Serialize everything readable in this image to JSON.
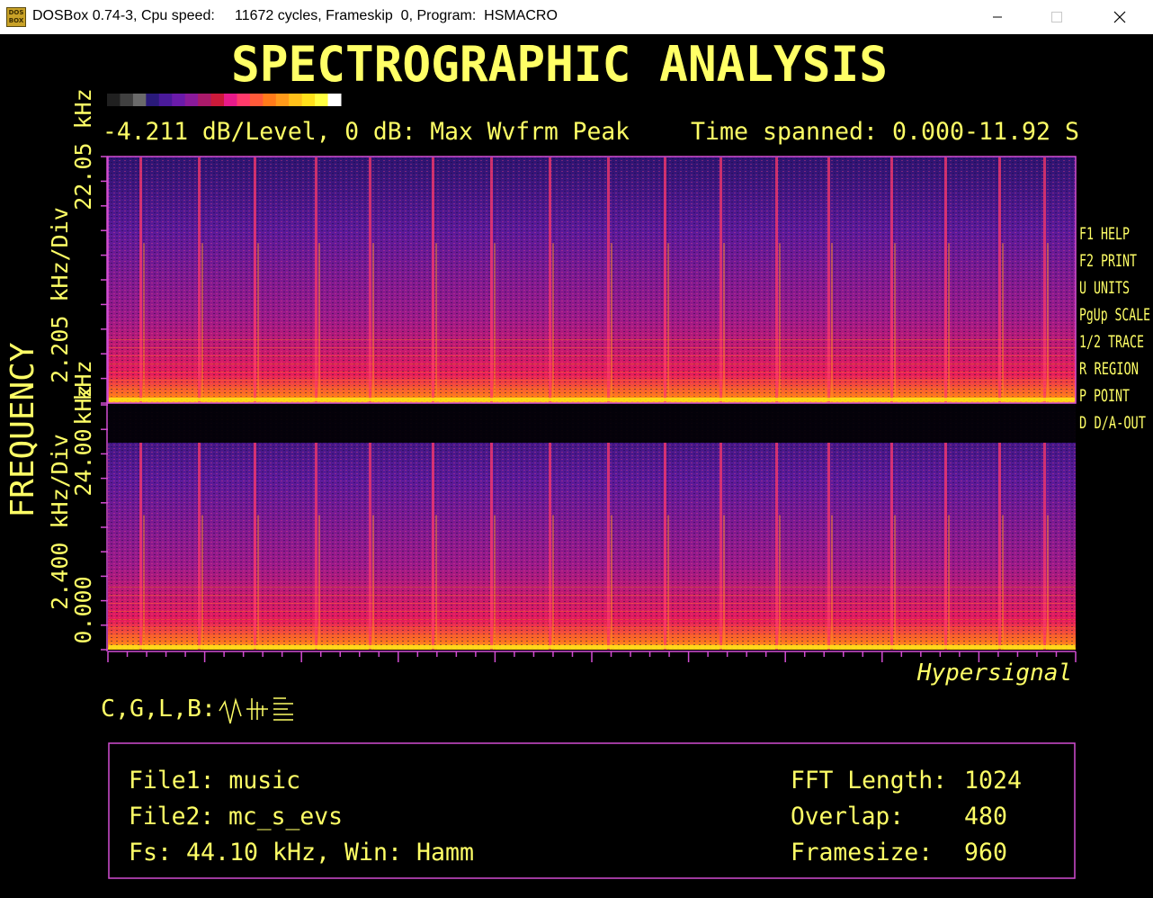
{
  "window": {
    "title": "DOSBox 0.74-3, Cpu speed:     11672 cycles, Frameskip  0, Program:  HSMACRO",
    "icon": "dosbox-icon",
    "icon_text": "DOS BOX"
  },
  "screen": {
    "title": "SPECTROGRAPHIC ANALYSIS",
    "level_info": "-4.211 dB/Level, 0 dB: Max Wvfrm Peak",
    "time_spanned": "Time spanned: 0.000-11.92 S",
    "y_axis_label": "FREQUENCY",
    "top_axis": {
      "scale": "2.205 kHz/Div",
      "top_value": "22.05 kHz",
      "bottom_value": "kHz"
    },
    "bottom_axis": {
      "scale": "2.400 kHz/Div",
      "top_value": "24.00",
      "bottom_value": "0.000",
      "bottom_unit": "kHz"
    },
    "menu": [
      "F1 HELP",
      "F2 PRINT",
      "U UNITS",
      "PgUp SCALE",
      "1/2 TRACE",
      "R REGION",
      "P POINT",
      "D D/A-OUT"
    ],
    "brand": "Hypersignal",
    "mode_label": "C,G,L,B:",
    "mode_icons": [
      "waveform-icon",
      "spectrum-icon",
      "list-icon"
    ],
    "info": {
      "file1": "File1: music",
      "file2": "File2: mc_s_evs",
      "fs": "Fs: 44.10 kHz, Win: Hamm",
      "fft_label": "FFT Length:",
      "fft_value": "1024",
      "overlap_label": "Overlap:",
      "overlap_value": "480",
      "framesize_label": "Framesize:",
      "framesize_value": "960"
    },
    "colors": {
      "text": "#ffff66",
      "frame": "#d24dd2",
      "window_bg": "#ffffff",
      "screen_bg": "#000000"
    },
    "palette": [
      "#202020",
      "#404040",
      "#6a6a6a",
      "#2a1a7a",
      "#4a1a9a",
      "#6a1aaa",
      "#8a1a9a",
      "#aa1a6a",
      "#cc1a3a",
      "#e81a8a",
      "#ff3a6a",
      "#ff5a3a",
      "#ff7a1a",
      "#ff9a1a",
      "#ffc01a",
      "#ffe01a",
      "#ffff40",
      "#ffffff"
    ]
  }
}
